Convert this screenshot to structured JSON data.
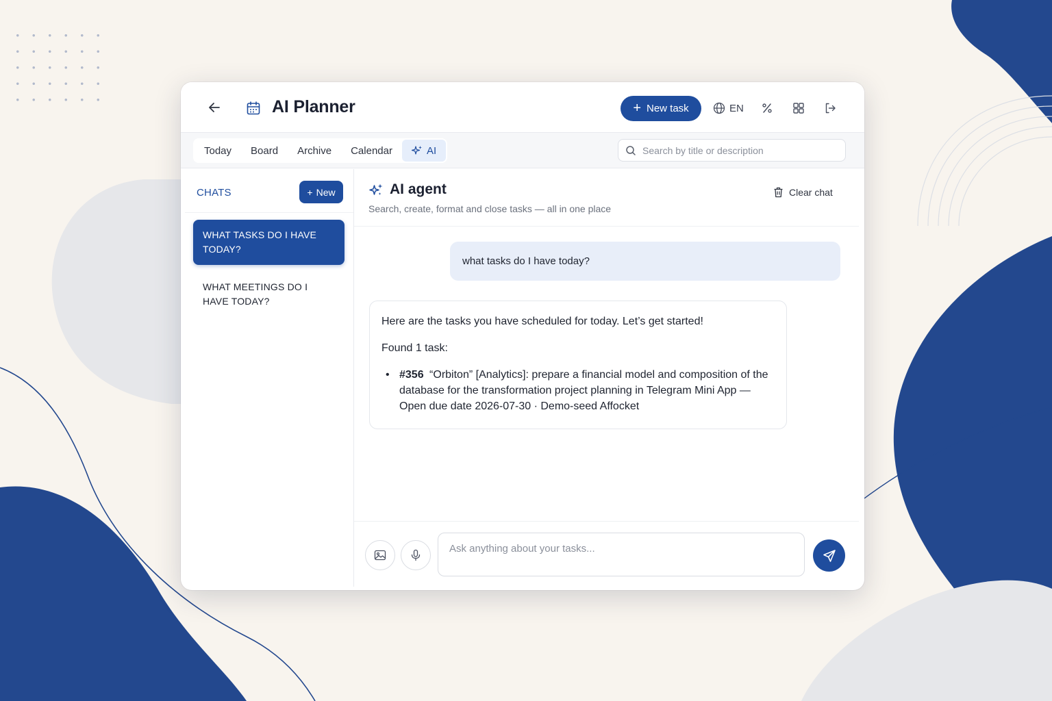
{
  "header": {
    "title": "AI Planner",
    "new_task_label": "New task",
    "language": "EN",
    "back_icon": "arrow-left-icon",
    "calendar_icon": "calendar-icon",
    "globe_icon": "globe-icon",
    "percent_icon": "percent-icon",
    "grid_icon": "grid-icon",
    "logout_icon": "logout-icon"
  },
  "nav": {
    "tabs": [
      {
        "label": "Today"
      },
      {
        "label": "Board"
      },
      {
        "label": "Archive"
      },
      {
        "label": "Calendar"
      },
      {
        "label": "AI",
        "active": true
      }
    ],
    "search_placeholder": "Search by title or description"
  },
  "sidebar": {
    "heading": "CHATS",
    "new_label": "New",
    "chats": [
      {
        "title": "WHAT TASKS DO I HAVE TODAY?",
        "active": true
      },
      {
        "title": "WHAT MEETINGS DO I HAVE TODAY?",
        "active": false
      }
    ]
  },
  "agent": {
    "title": "AI agent",
    "subtitle": "Search, create, format and close tasks — all in one place",
    "clear_label": "Clear chat"
  },
  "messages": {
    "user": "what tasks do I have today?",
    "ai_intro": "Here are the tasks you have scheduled for today. Let’s get started!",
    "ai_found": "Found 1 task:",
    "task_id": "#356",
    "task_text": "“Orbiton” [Analytics]: prepare a financial model and composition of the database for the transformation project planning in Telegram Mini App — Open due date 2026-07-30 · Demo-seed Affocket"
  },
  "composer": {
    "placeholder": "Ask anything about your tasks...",
    "image_icon": "image-icon",
    "mic_icon": "microphone-icon",
    "send_icon": "send-icon"
  },
  "colors": {
    "accent": "#1f4d9e",
    "background": "#f8f4ee",
    "user_bubble": "#e8eef9"
  }
}
